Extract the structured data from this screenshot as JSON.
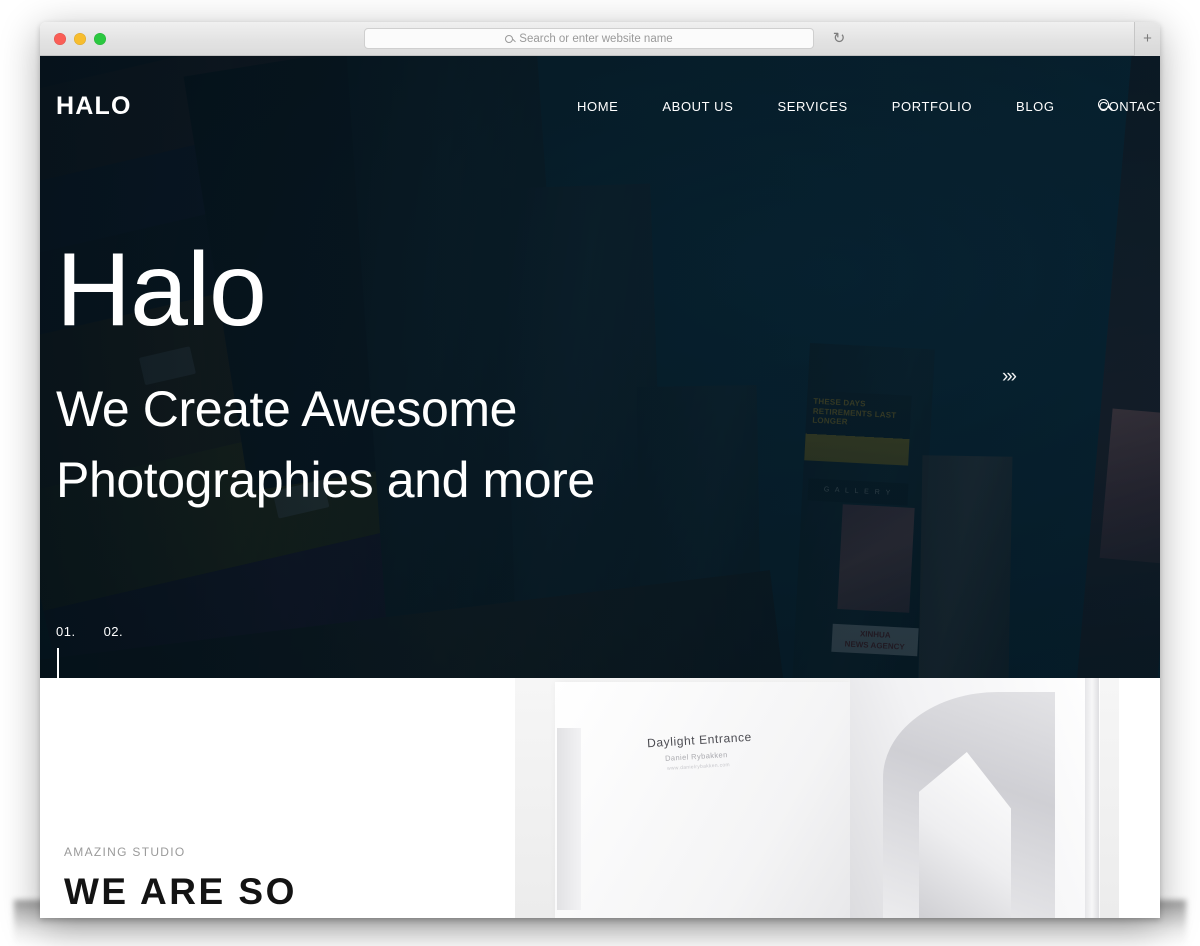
{
  "browser": {
    "traffic_lights": [
      {
        "name": "close",
        "color": "#fa5e57"
      },
      {
        "name": "minimize",
        "color": "#f7bd2e"
      },
      {
        "name": "maximize",
        "color": "#2bc840"
      }
    ],
    "address_bar": {
      "value": "",
      "placeholder": "Search or enter website name",
      "search_icon": "search-icon"
    },
    "reload_icon": "↻",
    "new_tab_icon": "+"
  },
  "site": {
    "logo": "HALO",
    "nav": [
      {
        "label": "HOME"
      },
      {
        "label": "ABOUT US"
      },
      {
        "label": "SERVICES"
      },
      {
        "label": "PORTFOLIO"
      },
      {
        "label": "BLOG"
      },
      {
        "label": "CONTACT"
      }
    ],
    "search_icon": "search-icon"
  },
  "hero": {
    "title": "Halo",
    "subtitle": "We Create Awesome Photographies and more",
    "next_arrows": "›››",
    "slides": [
      {
        "label": "01.",
        "active": true
      },
      {
        "label": "02.",
        "active": false
      }
    ],
    "background_description": "Times Square billboards at dusk",
    "background_billboards": {
      "gold_board": "THESE DAYS RETIREMENTS LAST LONGER",
      "gallery_board": "G A L L E R Y",
      "news_board_line1": "XINHUA",
      "news_board_line2": "NEWS AGENCY"
    },
    "overlay_color": "#0a2c40"
  },
  "about": {
    "eyebrow": "AMAZING STUDIO",
    "heading": "WE ARE SO",
    "image": {
      "book_title": "Daylight Entrance",
      "book_author": "Daniel Rybakken",
      "book_subtitle": "www.danielrybakken.com"
    }
  }
}
